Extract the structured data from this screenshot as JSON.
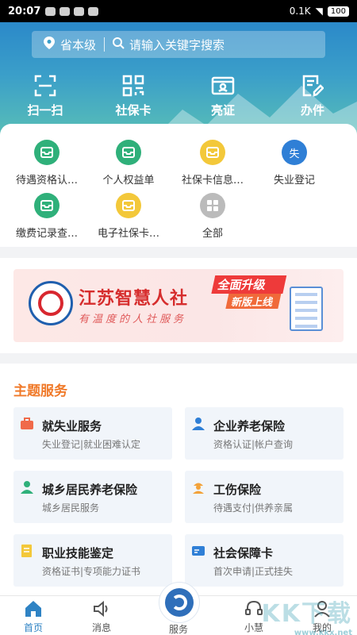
{
  "status": {
    "time": "20:07",
    "net": "0.1K",
    "battery": "100"
  },
  "search": {
    "location": "省本级",
    "placeholder": "请输入关键字搜索"
  },
  "quick_actions": [
    {
      "label": "扫一扫",
      "icon": "scan-icon"
    },
    {
      "label": "社保卡",
      "icon": "qrcode-icon"
    },
    {
      "label": "亮证",
      "icon": "id-card-icon"
    },
    {
      "label": "办件",
      "icon": "document-edit-icon"
    }
  ],
  "services": [
    {
      "label": "待遇资格认…",
      "color": "#2fb07a"
    },
    {
      "label": "个人权益单",
      "color": "#2fb07a"
    },
    {
      "label": "社保卡信息…",
      "color": "#f3c83a"
    },
    {
      "label": "失业登记",
      "color": "#2f7fd6",
      "glyph": "失"
    },
    {
      "label": "缴费记录查…",
      "color": "#2fb07a"
    },
    {
      "label": "电子社保卡…",
      "color": "#f3c83a"
    },
    {
      "label": "全部",
      "color": "#bbbbbb"
    }
  ],
  "banner": {
    "title": "江苏智慧人社",
    "subtitle": "有温度的人社服务",
    "badge_top": "全面升级",
    "badge_bottom": "新版上线"
  },
  "topics": {
    "title": "主题服务",
    "items": [
      {
        "name": "就失业服务",
        "desc": "失业登记|就业困难认定",
        "color": "#f06a4a"
      },
      {
        "name": "企业养老保险",
        "desc": "资格认证|帐户查询",
        "color": "#2f7fd6"
      },
      {
        "name": "城乡居民养老保险",
        "desc": "城乡居民服务",
        "color": "#2fb07a"
      },
      {
        "name": "工伤保险",
        "desc": "待遇支付|供养亲属",
        "color": "#f3a23a"
      },
      {
        "name": "职业技能鉴定",
        "desc": "资格证书|专项能力证书",
        "color": "#f3c83a"
      },
      {
        "name": "社会保障卡",
        "desc": "首次申请|正式挂失",
        "color": "#2f7fd6"
      }
    ]
  },
  "tabbar": {
    "home": "首页",
    "messages": "消息",
    "services": "服务",
    "assistant": "小慧",
    "mine": "我的"
  },
  "watermark": {
    "main": "KK下载",
    "url": "www.kkx.net"
  }
}
